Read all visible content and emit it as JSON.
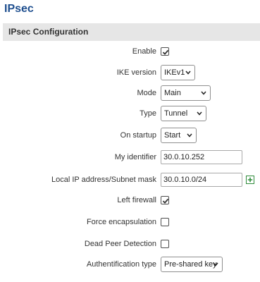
{
  "page": {
    "title": "IPsec"
  },
  "section": {
    "title": "IPsec Configuration"
  },
  "fields": {
    "enable": {
      "label": "Enable",
      "checked": true
    },
    "ike_version": {
      "label": "IKE version",
      "value": "IKEv1"
    },
    "mode": {
      "label": "Mode",
      "value": "Main"
    },
    "type": {
      "label": "Type",
      "value": "Tunnel"
    },
    "on_startup": {
      "label": "On startup",
      "value": "Start"
    },
    "my_identifier": {
      "label": "My identifier",
      "value": "30.0.10.252"
    },
    "local_ip": {
      "label": "Local IP address/Subnet mask",
      "value": "30.0.10.0/24",
      "add_icon": "plus-square-icon"
    },
    "left_firewall": {
      "label": "Left firewall",
      "checked": true
    },
    "force_encapsulation": {
      "label": "Force encapsulation",
      "checked": false
    },
    "dead_peer_detection": {
      "label": "Dead Peer Detection",
      "checked": false
    },
    "auth_type": {
      "label": "Authentification type",
      "value": "Pre-shared key"
    }
  },
  "colors": {
    "title": "#1f4f8f",
    "header_bg": "#e6e6e6",
    "add_icon": "#2e8b3a"
  }
}
